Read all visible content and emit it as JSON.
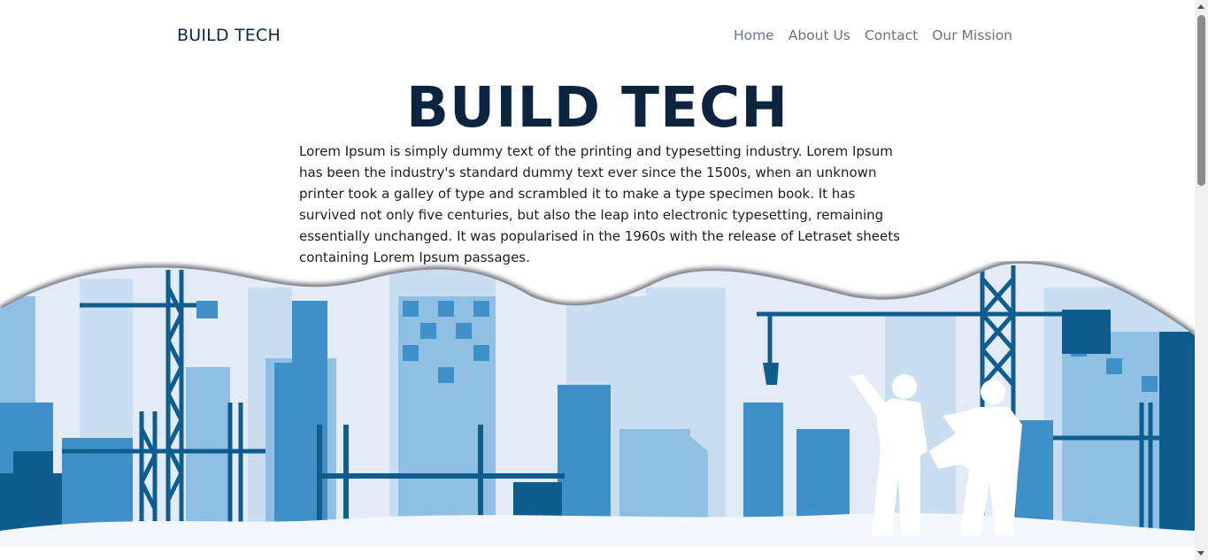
{
  "navbar": {
    "brand": "BUILD TECH",
    "links": [
      {
        "label": "Home"
      },
      {
        "label": "About Us"
      },
      {
        "label": "Contact"
      },
      {
        "label": "Our Mission"
      }
    ]
  },
  "hero": {
    "title": "BUILD TECH",
    "description": "Lorem Ipsum is simply dummy text of the printing and typesetting industry. Lorem Ipsum has been the industry's standard dummy text ever since the 1500s, when an unknown printer took a galley of type and scrambled it to make a type specimen book. It has survived not only five centuries, but also the leap into electronic typesetting, remaining essentially unchanged. It was popularised in the 1960s with the release of Letraset sheets containing Lorem Ipsum passages."
  },
  "illustration": {
    "subject": "construction-city-skyline",
    "colors": {
      "dark": "#0f5c8f",
      "mid": "#3f8fc8",
      "light": "#8fc0e3",
      "pale": "#c9def0",
      "sky": "#e3ecf6",
      "ground": "#f4f7fb"
    }
  },
  "theme": {
    "brand_color": "#0d2440",
    "nav_color": "#6c757d"
  }
}
